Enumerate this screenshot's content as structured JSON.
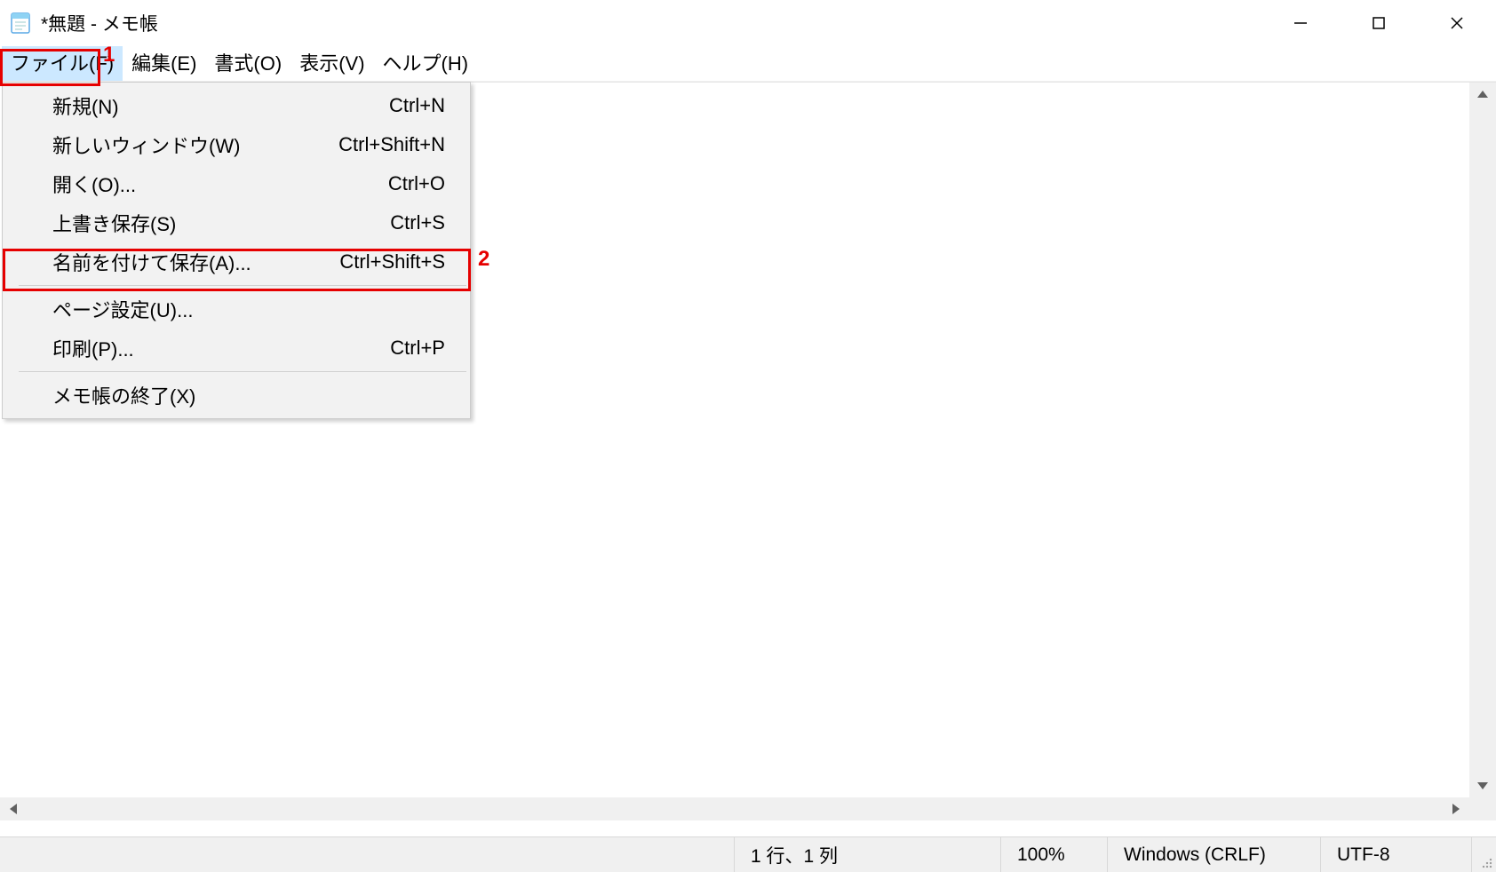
{
  "window": {
    "title": "*無題 - メモ帳"
  },
  "menubar": {
    "file": "ファイル(F)",
    "edit": "編集(E)",
    "format": "書式(O)",
    "view": "表示(V)",
    "help": "ヘルプ(H)"
  },
  "file_menu": {
    "new": {
      "label": "新規(N)",
      "accel": "Ctrl+N"
    },
    "new_window": {
      "label": "新しいウィンドウ(W)",
      "accel": "Ctrl+Shift+N"
    },
    "open": {
      "label": "開く(O)...",
      "accel": "Ctrl+O"
    },
    "save": {
      "label": "上書き保存(S)",
      "accel": "Ctrl+S"
    },
    "save_as": {
      "label": "名前を付けて保存(A)...",
      "accel": "Ctrl+Shift+S"
    },
    "page_setup": {
      "label": "ページ設定(U)...",
      "accel": ""
    },
    "print": {
      "label": "印刷(P)...",
      "accel": "Ctrl+P"
    },
    "exit": {
      "label": "メモ帳の終了(X)",
      "accel": ""
    }
  },
  "status": {
    "position": "1 行、1 列",
    "zoom": "100%",
    "eol": "Windows (CRLF)",
    "encoding": "UTF-8"
  },
  "annotations": {
    "one": "1",
    "two": "2"
  }
}
